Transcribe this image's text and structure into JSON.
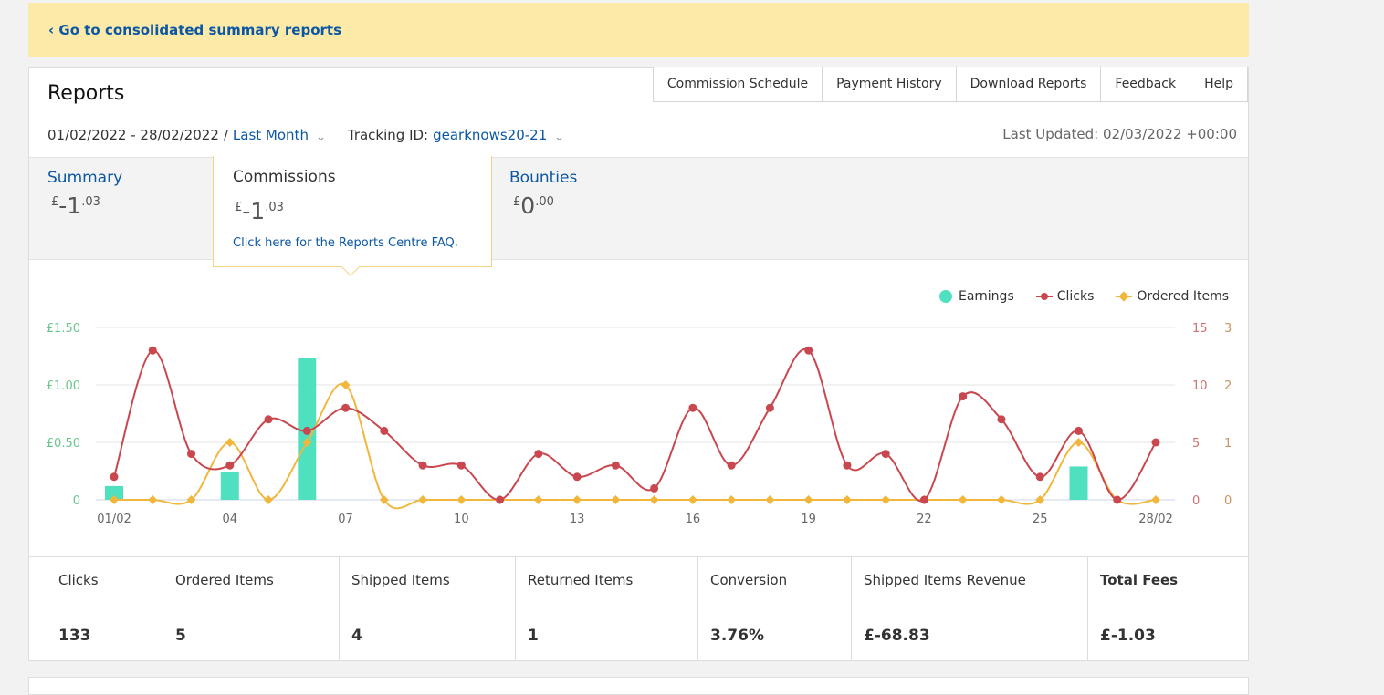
{
  "banner": {
    "back_link": "‹ Go to consolidated summary reports"
  },
  "header": {
    "title": "Reports",
    "tabs": [
      "Commission Schedule",
      "Payment History",
      "Download Reports",
      "Feedback",
      "Help"
    ],
    "date_range": "01/02/2022 - 28/02/2022",
    "separator": "/",
    "range_preset": "Last Month",
    "tracking_label": "Tracking ID:",
    "tracking_id": "gearknows20-21",
    "last_updated": "Last Updated: 02/03/2022 +00:00"
  },
  "summary_tabs": {
    "summary": {
      "label": "Summary",
      "currency": "£",
      "int": "-1",
      "dec": ".03"
    },
    "commissions": {
      "label": "Commissions",
      "currency": "£",
      "int": "-1",
      "dec": ".03",
      "faq": "Click here for the Reports Centre FAQ."
    },
    "bounties": {
      "label": "Bounties",
      "currency": "£",
      "int": "0",
      "dec": ".00"
    }
  },
  "legend": {
    "earnings": "Earnings",
    "clicks": "Clicks",
    "ordered": "Ordered Items"
  },
  "colors": {
    "earnings": "#4fe0bf",
    "clicks": "#c9474f",
    "ordered": "#f0b73c",
    "link": "#0b57a3",
    "banner": "#fde9a8"
  },
  "chart_data": {
    "type": "line",
    "x": [
      "01/02",
      "02/02",
      "03/02",
      "04/02",
      "05/02",
      "06/02",
      "07/02",
      "08/02",
      "09/02",
      "10/02",
      "11/02",
      "12/02",
      "13/02",
      "14/02",
      "15/02",
      "16/02",
      "17/02",
      "18/02",
      "19/02",
      "20/02",
      "21/02",
      "22/02",
      "23/02",
      "24/02",
      "25/02",
      "26/02",
      "27/02",
      "28/02"
    ],
    "x_tick_labels": [
      "01/02",
      "04",
      "07",
      "10",
      "13",
      "16",
      "19",
      "22",
      "25",
      "28/02"
    ],
    "series": [
      {
        "name": "Earnings",
        "type": "bar",
        "axis": "left",
        "values": [
          0.12,
          0,
          0,
          0.24,
          0,
          1.23,
          0,
          0,
          0,
          0,
          0,
          0,
          0,
          0,
          0,
          0,
          0,
          0,
          0,
          0,
          0,
          0,
          0,
          0,
          0,
          0.29,
          0,
          0
        ]
      },
      {
        "name": "Clicks",
        "type": "line",
        "axis": "right-1",
        "values": [
          2,
          13,
          4,
          3,
          7,
          6,
          8,
          6,
          3,
          3,
          0,
          4,
          2,
          3,
          1,
          8,
          3,
          8,
          13,
          3,
          4,
          0,
          9,
          7,
          2,
          6,
          0,
          5
        ]
      },
      {
        "name": "Ordered Items",
        "type": "line",
        "axis": "right-2",
        "values": [
          0,
          0,
          0,
          1,
          0,
          1,
          2,
          0,
          0,
          0,
          0,
          0,
          0,
          0,
          0,
          0,
          0,
          0,
          0,
          0,
          0,
          0,
          0,
          0,
          0,
          1,
          0,
          0
        ]
      }
    ],
    "left_axis": {
      "ticks": [
        "0",
        "£0.50",
        "£1.00",
        "£1.50"
      ],
      "ylim": [
        0,
        1.5
      ]
    },
    "right_axis_1": {
      "ticks": [
        "0",
        "5",
        "10",
        "15"
      ],
      "ylim": [
        0,
        15
      ]
    },
    "right_axis_2": {
      "ticks": [
        "0",
        "1",
        "2",
        "3"
      ],
      "ylim": [
        0,
        3
      ]
    },
    "grid": true,
    "legend_position": "top-right"
  },
  "stats": [
    {
      "label": "Clicks",
      "value": "133"
    },
    {
      "label": "Ordered Items",
      "value": "5"
    },
    {
      "label": "Shipped Items",
      "value": "4"
    },
    {
      "label": "Returned Items",
      "value": "1"
    },
    {
      "label": "Conversion",
      "value": "3.76%"
    },
    {
      "label": "Shipped Items Revenue",
      "value": "£-68.83"
    },
    {
      "label": "Total Fees",
      "value": "£-1.03"
    }
  ]
}
